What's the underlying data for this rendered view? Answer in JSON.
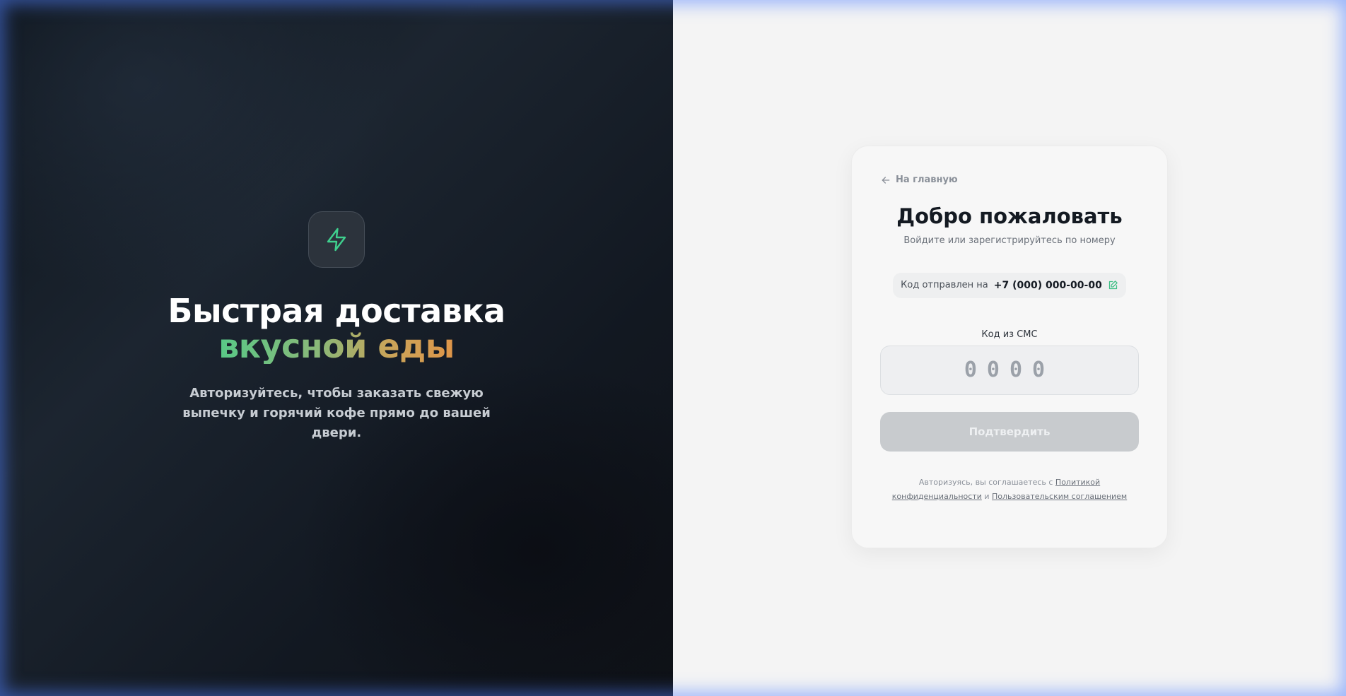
{
  "hero": {
    "title_line1": "Быстрая доставка",
    "title_line2": "вкусной еды",
    "subtitle": "Авторизуйтесь, чтобы заказать свежую выпечку и горячий кофе прямо до вашей двери.",
    "logo_icon": "lightning-icon",
    "accent_color": "#3fd08e"
  },
  "auth": {
    "back_label": "На главную",
    "title": "Добро пожаловать",
    "subtitle": "Войдите или зарегистрируйтесь по номеру",
    "sent_label": "Код отправлен на",
    "phone": "+7 (000) 000-00-00",
    "code_label": "Код из СМС",
    "code_placeholder": "0000",
    "confirm_label": "Подтвердить",
    "legal_prefix": "Авторизуясь, вы соглашаетесь с",
    "privacy_link": "Политикой конфиденциальности",
    "legal_and": "и",
    "terms_link": "Пользовательским соглашением"
  }
}
